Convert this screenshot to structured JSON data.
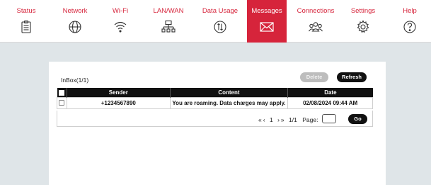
{
  "nav": {
    "tabs": [
      {
        "label": "Status",
        "icon": "clipboard-icon"
      },
      {
        "label": "Network",
        "icon": "globe-icon"
      },
      {
        "label": "Wi-Fi",
        "icon": "wifi-icon"
      },
      {
        "label": "LAN/WAN",
        "icon": "network-icon"
      },
      {
        "label": "Data Usage",
        "icon": "data-usage-icon"
      },
      {
        "label": "Messages",
        "icon": "envelope-icon",
        "active": true
      },
      {
        "label": "Connections",
        "icon": "users-icon"
      },
      {
        "label": "Settings",
        "icon": "gear-icon"
      },
      {
        "label": "Help",
        "icon": "help-icon"
      }
    ]
  },
  "inbox": {
    "title": "InBox(1/1)",
    "delete_label": "Delete",
    "refresh_label": "Refresh",
    "columns": [
      "Sender",
      "Content",
      "Date"
    ],
    "rows": [
      {
        "sender": "+1234567890",
        "content": "You are roaming. Data charges may apply.",
        "date": "02/08/2024 09:44 AM"
      }
    ],
    "pager": {
      "first": "«",
      "prev": "‹",
      "current": "1",
      "next": "›",
      "last": "»",
      "total": "1/1",
      "page_label": "Page:",
      "go_label": "Go"
    }
  },
  "colors": {
    "accent": "#d6243b",
    "background": "#dfe5e8"
  }
}
